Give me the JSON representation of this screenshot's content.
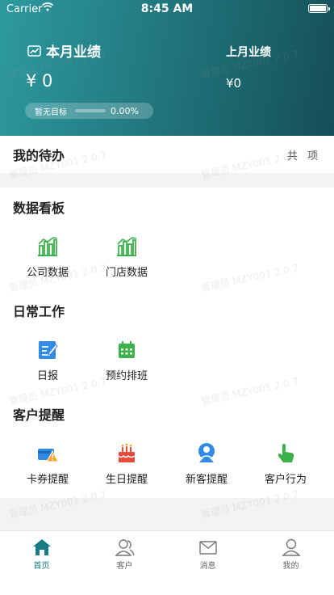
{
  "status_bar": {
    "carrier": "Carrier",
    "time": "8:45 AM"
  },
  "performance": {
    "month_title": "本月业绩",
    "month_value": "¥ 0",
    "last_month_title": "上月业绩",
    "last_month_value": "¥0",
    "target_label": "暂无目标",
    "target_percent": "0.00%",
    "progress_fraction": 0.0
  },
  "todo": {
    "title": "我的待办",
    "count_label": "共 项"
  },
  "sections": {
    "dashboard": {
      "title": "数据看板",
      "items": [
        {
          "label": "公司数据",
          "icon": "bar-chart-icon"
        },
        {
          "label": "门店数据",
          "icon": "bar-chart-icon"
        }
      ]
    },
    "daily": {
      "title": "日常工作",
      "items": [
        {
          "label": "日报",
          "icon": "edit-report-icon"
        },
        {
          "label": "预约排班",
          "icon": "calendar-icon"
        }
      ]
    },
    "reminders": {
      "title": "客户提醒",
      "items": [
        {
          "label": "卡券提醒",
          "icon": "card-warning-icon"
        },
        {
          "label": "生日提醒",
          "icon": "birthday-cake-icon"
        },
        {
          "label": "新客提醒",
          "icon": "new-customer-icon"
        },
        {
          "label": "客户行为",
          "icon": "pointer-hand-icon"
        }
      ]
    }
  },
  "tabbar": [
    {
      "label": "首页",
      "icon": "home-icon",
      "active": true
    },
    {
      "label": "客户",
      "icon": "customers-icon",
      "active": false
    },
    {
      "label": "消息",
      "icon": "message-icon",
      "active": false
    },
    {
      "label": "我的",
      "icon": "profile-icon",
      "active": false
    }
  ],
  "watermark": "管理员 MZY001 2.0.7",
  "colors": {
    "accent": "#197b84",
    "header_start": "#2d9aa0",
    "header_end": "#154e57",
    "icon_green": "#3cb34a",
    "icon_blue": "#2f8be6",
    "icon_red": "#e84b3c"
  }
}
